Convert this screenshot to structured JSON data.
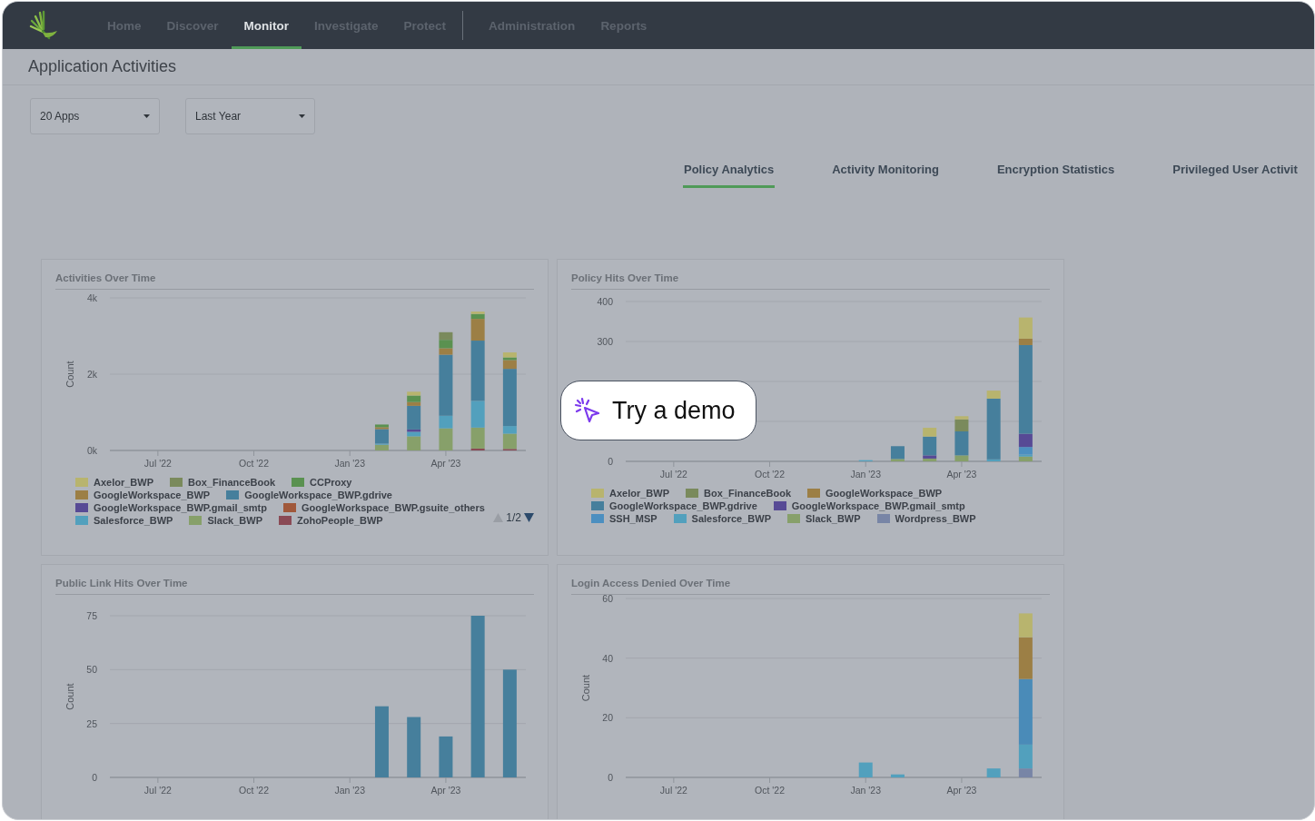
{
  "nav": {
    "primary": [
      {
        "label": "Home",
        "selected": false
      },
      {
        "label": "Discover",
        "selected": false
      },
      {
        "label": "Monitor",
        "selected": true
      },
      {
        "label": "Investigate",
        "selected": false
      },
      {
        "label": "Protect",
        "selected": false
      }
    ],
    "secondary": [
      {
        "label": "Administration",
        "selected": false
      },
      {
        "label": "Reports",
        "selected": false
      }
    ]
  },
  "page_title": "Application Activities",
  "filters": [
    {
      "value": "20 Apps"
    },
    {
      "value": "Last Year"
    }
  ],
  "tabs": [
    {
      "label": "Policy Analytics",
      "selected": true
    },
    {
      "label": "Activity Monitoring",
      "selected": false
    },
    {
      "label": "Encryption Statistics",
      "selected": false
    },
    {
      "label": "Privileged User Activit",
      "selected": false
    }
  ],
  "charts": [
    {
      "title": "Activities Over Time",
      "legend_pager": {
        "text": "1/2",
        "prev_disabled": true,
        "next_disabled": false
      },
      "chart_data": {
        "type": "bar",
        "stacked": true,
        "ylabel": "Count",
        "ylim": [
          0,
          4
        ],
        "categories": [
          null,
          "Jul '22",
          null,
          null,
          "Oct '22",
          null,
          null,
          "Jan '23",
          null,
          null,
          "Apr '23",
          null,
          null
        ],
        "yticks": [
          {
            "value": 0,
            "label": "0k"
          },
          {
            "value": 2,
            "label": "2k"
          },
          {
            "value": 4,
            "label": "4k"
          }
        ],
        "series": [
          {
            "name": "ZohoPeople_BWP",
            "color": "#8a4a55",
            "values": [
              0,
              0,
              0,
              0,
              0,
              0,
              0,
              0,
              0,
              0,
              0,
              0.05,
              0.04
            ]
          },
          {
            "name": "Slack_BWP",
            "color": "#87a06a",
            "values": [
              0,
              0,
              0,
              0,
              0,
              0,
              0,
              0,
              0.15,
              0.37,
              0.58,
              0.55,
              0.4
            ]
          },
          {
            "name": "Salesforce_BWP",
            "color": "#52a0bd",
            "values": [
              0,
              0,
              0,
              0,
              0,
              0,
              0,
              0,
              0.03,
              0.12,
              0.33,
              0.7,
              0.2
            ]
          },
          {
            "name": "GoogleWorkspace_BWP.gsuite_others",
            "color": "#a0583a",
            "values": [
              0,
              0,
              0,
              0,
              0,
              0,
              0,
              0,
              0,
              0,
              0,
              0,
              0
            ]
          },
          {
            "name": "GoogleWorkspace_BWP.gmail_smtp",
            "color": "#574a95",
            "values": [
              0,
              0,
              0,
              0,
              0,
              0,
              0,
              0,
              0,
              0.06,
              0,
              0,
              0
            ]
          },
          {
            "name": "GoogleWorkspace_BWP.gdrive",
            "color": "#467f9c",
            "values": [
              0,
              0,
              0,
              0,
              0,
              0,
              0,
              0,
              0.38,
              0.62,
              1.6,
              1.58,
              1.5
            ]
          },
          {
            "name": "GoogleWorkspace_BWP",
            "color": "#9c7f45",
            "values": [
              0,
              0,
              0,
              0,
              0,
              0,
              0,
              0,
              0.05,
              0.1,
              0.17,
              0.57,
              0.23
            ]
          },
          {
            "name": "CCProxy",
            "color": "#5a9150",
            "values": [
              0,
              0,
              0,
              0,
              0,
              0,
              0,
              0,
              0.07,
              0.17,
              0.22,
              0.13,
              0.07
            ]
          },
          {
            "name": "Box_FinanceBook",
            "color": "#7a8a5c",
            "values": [
              0,
              0,
              0,
              0,
              0,
              0,
              0,
              0,
              0,
              0,
              0.2,
              0,
              0
            ]
          },
          {
            "name": "Axelor_BWP",
            "color": "#b8b46e",
            "values": [
              0,
              0,
              0,
              0,
              0,
              0,
              0,
              0,
              0,
              0.1,
              0,
              0.06,
              0.13
            ]
          }
        ]
      }
    },
    {
      "title": "Policy Hits Over Time",
      "chart_data": {
        "type": "bar",
        "stacked": true,
        "ylim": [
          0,
          400
        ],
        "categories": [
          null,
          "Jul '22",
          null,
          null,
          "Oct '22",
          null,
          null,
          "Jan '23",
          null,
          null,
          "Apr '23",
          null,
          null
        ],
        "yticks": [
          0,
          300,
          400
        ],
        "series": [
          {
            "name": "Wordpress_BWP",
            "color": "#7885a6",
            "values": [
              0,
              0,
              0,
              0,
              0,
              0,
              0,
              0,
              0,
              0,
              0,
              0,
              0
            ]
          },
          {
            "name": "Slack_BWP",
            "color": "#87a06a",
            "values": [
              0,
              0,
              0,
              0,
              0,
              0,
              0,
              0,
              6,
              7,
              15,
              0,
              12
            ]
          },
          {
            "name": "Salesforce_BWP",
            "color": "#52a0bd",
            "values": [
              0,
              0,
              0,
              0,
              0,
              0,
              0,
              3,
              0,
              0,
              0,
              5,
              5
            ]
          },
          {
            "name": "SSH_MSP",
            "color": "#4c8fc0",
            "values": [
              0,
              0,
              0,
              0,
              0,
              0,
              0,
              0,
              0,
              0,
              0,
              0,
              19
            ]
          },
          {
            "name": "GoogleWorkspace_BWP.gmail_smtp",
            "color": "#574a95",
            "values": [
              0,
              0,
              0,
              0,
              0,
              0,
              0,
              0,
              0,
              8,
              0,
              0,
              33
            ]
          },
          {
            "name": "GoogleWorkspace_BWP.gdrive",
            "color": "#467f9c",
            "values": [
              0,
              0,
              0,
              0,
              0,
              0,
              0,
              0,
              32,
              47,
              60,
              152,
              222
            ]
          },
          {
            "name": "GoogleWorkspace_BWP",
            "color": "#9c7f45",
            "values": [
              0,
              0,
              0,
              0,
              0,
              0,
              0,
              0,
              0,
              0,
              0,
              0,
              16
            ]
          },
          {
            "name": "Box_FinanceBook",
            "color": "#7a8a5c",
            "values": [
              0,
              0,
              0,
              0,
              0,
              0,
              0,
              0,
              0,
              0,
              30,
              0,
              0
            ]
          },
          {
            "name": "Axelor_BWP",
            "color": "#b8b46e",
            "values": [
              0,
              0,
              0,
              0,
              0,
              0,
              0,
              0,
              0,
              22,
              8,
              20,
              53
            ]
          }
        ]
      }
    },
    {
      "title": "Public Link Hits Over Time",
      "chart_data": {
        "type": "bar",
        "stacked": true,
        "ylabel": "Count",
        "ylim": [
          0,
          75
        ],
        "categories": [
          null,
          "Jul '22",
          null,
          null,
          "Oct '22",
          null,
          null,
          "Jan '23",
          null,
          null,
          "Apr '23",
          null,
          null
        ],
        "yticks": [
          0,
          25,
          50,
          75
        ],
        "series": [
          {
            "color": "#467f9c",
            "values": [
              0,
              0,
              0,
              0,
              0,
              0,
              0,
              0,
              33,
              28,
              19,
              75,
              50
            ]
          }
        ]
      }
    },
    {
      "title": "Login Access Denied Over Time",
      "chart_data": {
        "type": "bar",
        "stacked": true,
        "ylabel": "Count",
        "ylim": [
          0,
          60
        ],
        "categories": [
          null,
          "Jul '22",
          null,
          null,
          "Oct '22",
          null,
          null,
          "Jan '23",
          null,
          null,
          "Apr '23",
          null,
          null
        ],
        "yticks": [
          0,
          20,
          40,
          60
        ],
        "series": [
          {
            "color": "#7885a6",
            "values": [
              0,
              0,
              0,
              0,
              0,
              0,
              0,
              0,
              0,
              0,
              0,
              0,
              3
            ]
          },
          {
            "color": "#52a0bd",
            "values": [
              0,
              0,
              0,
              0,
              0,
              0,
              0,
              5,
              1,
              0,
              0,
              3,
              8
            ]
          },
          {
            "color": "#4a8bb8",
            "values": [
              0,
              0,
              0,
              0,
              0,
              0,
              0,
              0,
              0,
              0,
              0,
              0,
              22
            ]
          },
          {
            "color": "#9c7f45",
            "values": [
              0,
              0,
              0,
              0,
              0,
              0,
              0,
              0,
              0,
              0,
              0,
              0,
              14
            ]
          },
          {
            "color": "#b8b46e",
            "values": [
              0,
              0,
              0,
              0,
              0,
              0,
              0,
              0,
              0,
              0,
              0,
              0,
              8
            ]
          }
        ]
      }
    }
  ],
  "demo_button": {
    "label": "Try a demo"
  }
}
